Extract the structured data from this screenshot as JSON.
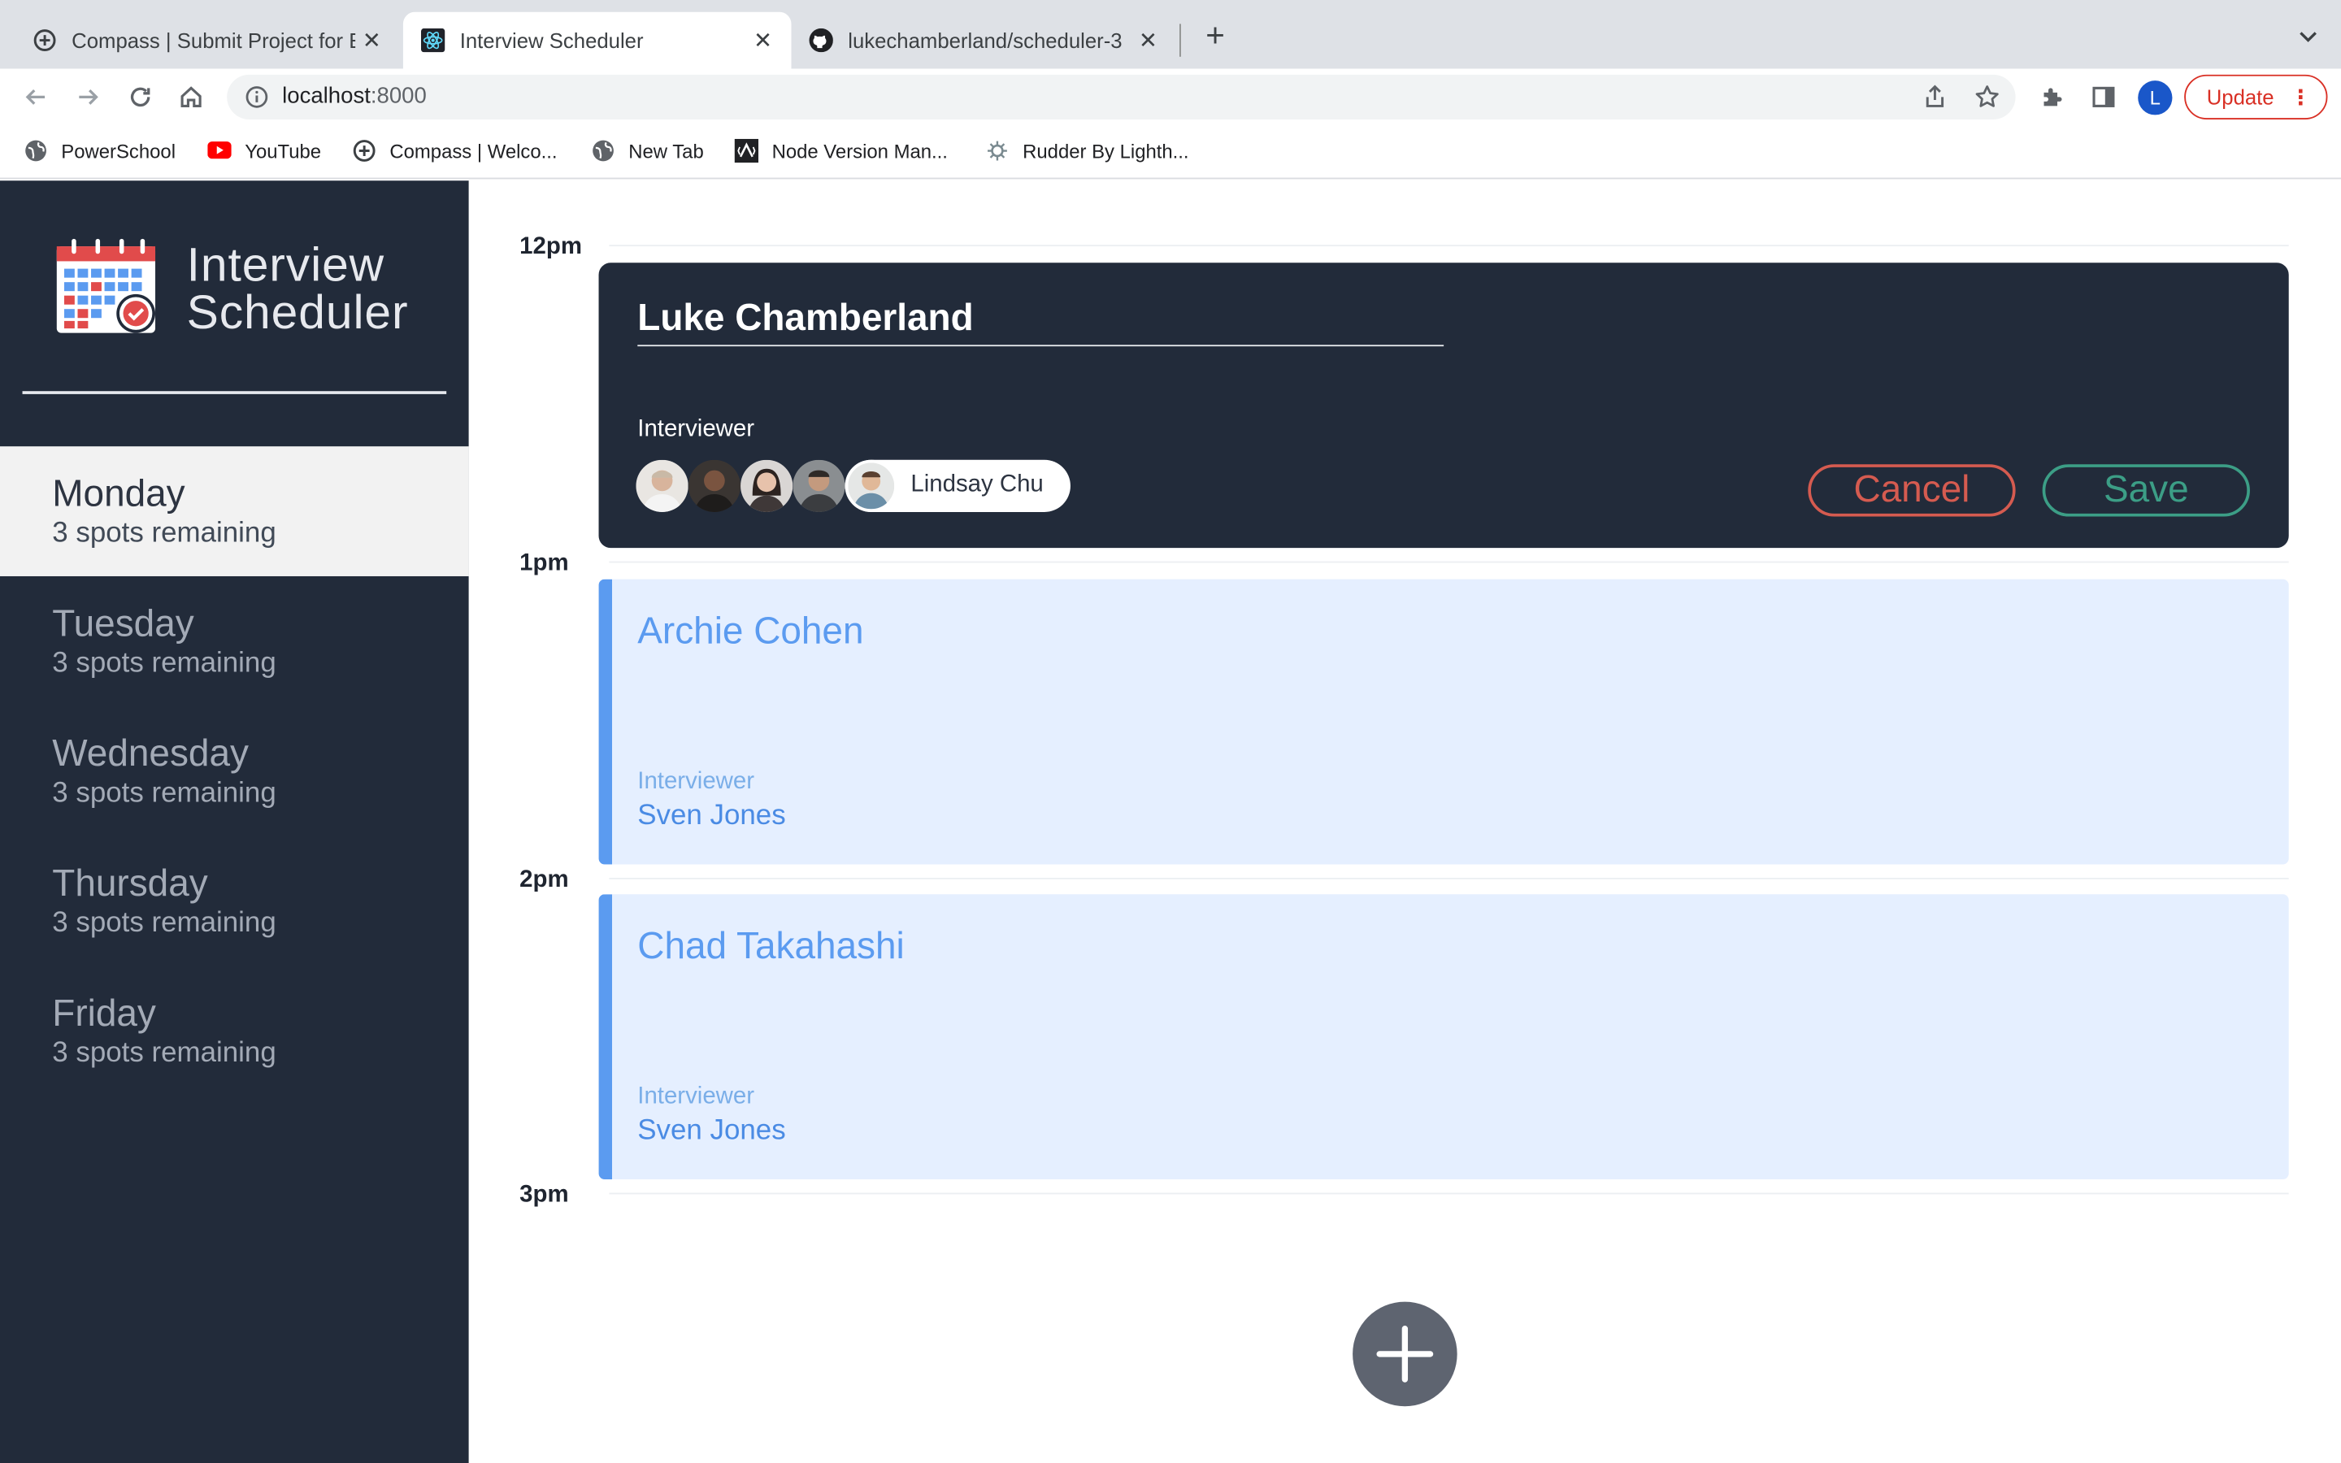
{
  "browser": {
    "tabs": [
      {
        "title": "Compass | Submit Project for E",
        "active": false
      },
      {
        "title": "Interview Scheduler",
        "active": true
      },
      {
        "title": "lukechamberland/scheduler-3",
        "active": false
      }
    ],
    "url_host": "localhost",
    "url_port": ":8000",
    "profile_initial": "L",
    "update_label": "Update",
    "bookmarks": [
      {
        "label": "PowerSchool"
      },
      {
        "label": "YouTube"
      },
      {
        "label": "Compass | Welco..."
      },
      {
        "label": "New Tab"
      },
      {
        "label": "Node Version Man..."
      },
      {
        "label": "Rudder By Lighth..."
      }
    ]
  },
  "sidebar": {
    "app_title_line1": "Interview",
    "app_title_line2": "Scheduler",
    "days": [
      {
        "name": "Monday",
        "spots": "3 spots remaining",
        "selected": true
      },
      {
        "name": "Tuesday",
        "spots": "3 spots remaining",
        "selected": false
      },
      {
        "name": "Wednesday",
        "spots": "3 spots remaining",
        "selected": false
      },
      {
        "name": "Thursday",
        "spots": "3 spots remaining",
        "selected": false
      },
      {
        "name": "Friday",
        "spots": "3 spots remaining",
        "selected": false
      }
    ]
  },
  "schedule": {
    "times": [
      "12pm",
      "1pm",
      "2pm",
      "3pm"
    ],
    "form": {
      "student_value": "Luke Chamberland",
      "interviewer_label": "Interviewer",
      "selected_interviewer": "Lindsay Chu",
      "cancel_label": "Cancel",
      "save_label": "Save"
    },
    "appointments": [
      {
        "student": "Archie Cohen",
        "interviewer_label": "Interviewer",
        "interviewer": "Sven Jones"
      },
      {
        "student": "Chad Takahashi",
        "interviewer_label": "Interviewer",
        "interviewer": "Sven Jones"
      }
    ]
  },
  "colors": {
    "sidebar_bg": "#222b3a",
    "accent_blue": "#5b9bf0",
    "cancel_red": "#d55b50",
    "save_green": "#3c9e86"
  }
}
